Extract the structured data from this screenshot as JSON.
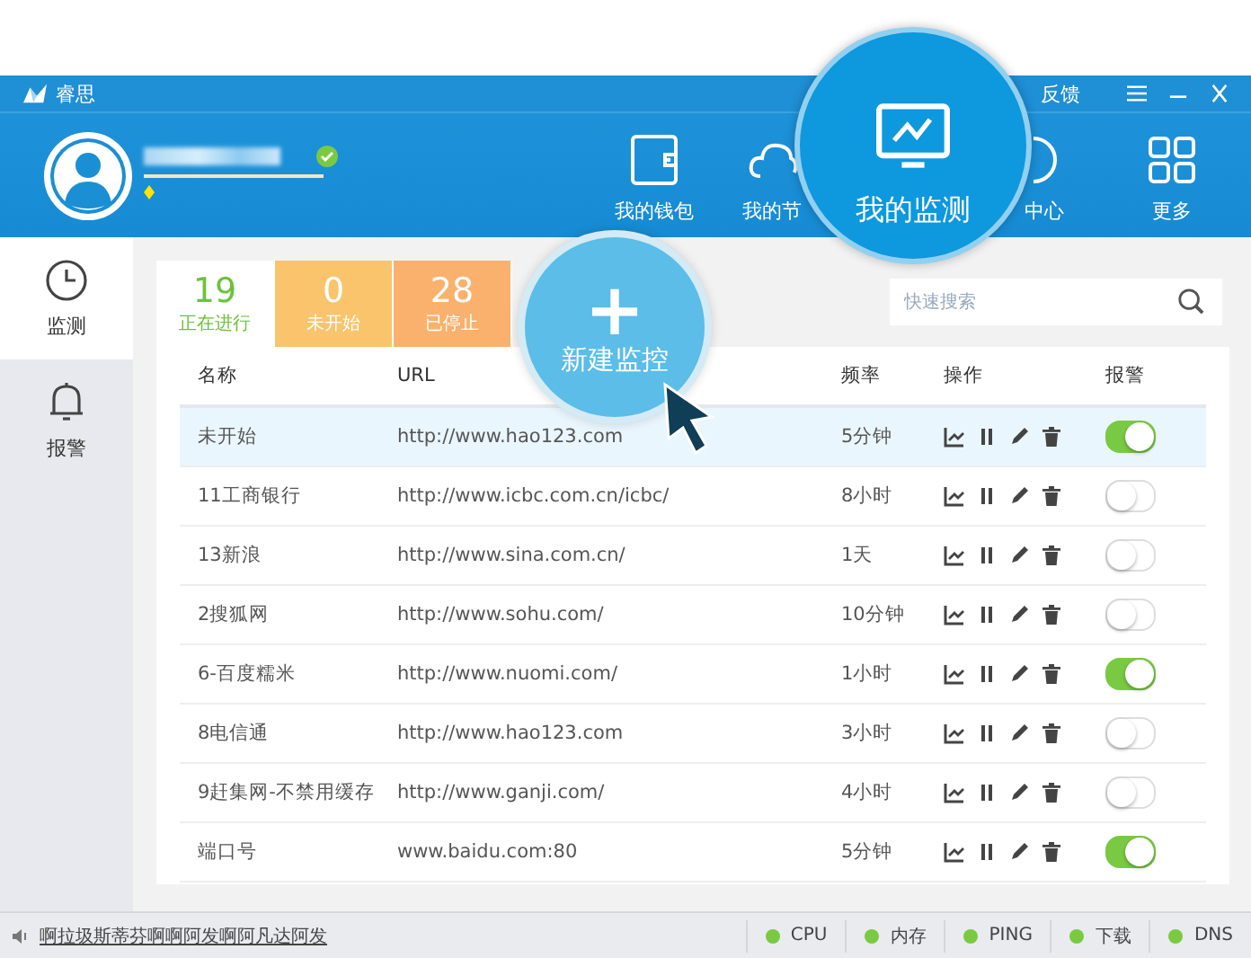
{
  "title_bar": {
    "title": "睿思",
    "feedback": "反馈"
  },
  "user": {
    "verified": true
  },
  "nav": [
    {
      "label": "我的钱包",
      "selected": false
    },
    {
      "label": "我的节",
      "selected": false
    },
    {
      "label": "我的监测",
      "selected": true
    },
    {
      "label": "中心",
      "selected": false
    },
    {
      "label": "更多",
      "selected": false
    }
  ],
  "sidebar": {
    "items": [
      {
        "label": "监测",
        "selected": true
      },
      {
        "label": "报警",
        "selected": false
      }
    ]
  },
  "stats": [
    {
      "count": "19",
      "label": "正在进行",
      "selected": true,
      "color": "#6cc23a"
    },
    {
      "count": "0",
      "label": "未开始",
      "selected": false,
      "color": "#f9c46b"
    },
    {
      "count": "28",
      "label": "已停止",
      "selected": false,
      "color": "#f9b16d"
    }
  ],
  "new_button": {
    "symbol": "+",
    "label": "新建监控"
  },
  "search": {
    "placeholder": "快速搜索"
  },
  "table": {
    "columns": [
      "名称",
      "URL",
      "频率",
      "操作",
      "报警"
    ],
    "rows": [
      {
        "name": "未开始",
        "url": "http://www.hao123.com",
        "frequency": "5分钟",
        "alert": true,
        "selected": true
      },
      {
        "name": "11工商银行",
        "url": "http://www.icbc.com.cn/icbc/",
        "frequency": "8小时",
        "alert": false,
        "selected": false
      },
      {
        "name": "13新浪",
        "url": "http://www.sina.com.cn/",
        "frequency": "1天",
        "alert": false,
        "selected": false
      },
      {
        "name": "2搜狐网",
        "url": "http://www.sohu.com/",
        "frequency": "10分钟",
        "alert": false,
        "selected": false
      },
      {
        "name": "6-百度糯米",
        "url": "http://www.nuomi.com/",
        "frequency": "1小时",
        "alert": true,
        "selected": false
      },
      {
        "name": "8电信通",
        "url": "http://www.hao123.com",
        "frequency": "3小时",
        "alert": false,
        "selected": false
      },
      {
        "name": "9赶集网-不禁用缓存",
        "url": "http://www.ganji.com/",
        "frequency": "4小时",
        "alert": false,
        "selected": false
      },
      {
        "name": "端口号",
        "url": "www.baidu.com:80",
        "frequency": "5分钟",
        "alert": true,
        "selected": false
      }
    ]
  },
  "status_bar": {
    "message": "啊拉圾斯蒂芬啊啊阿发啊阿凡达阿发",
    "indicators": [
      {
        "label": "CPU"
      },
      {
        "label": "内存"
      },
      {
        "label": "PING"
      },
      {
        "label": "下载"
      },
      {
        "label": "DNS"
      }
    ]
  }
}
